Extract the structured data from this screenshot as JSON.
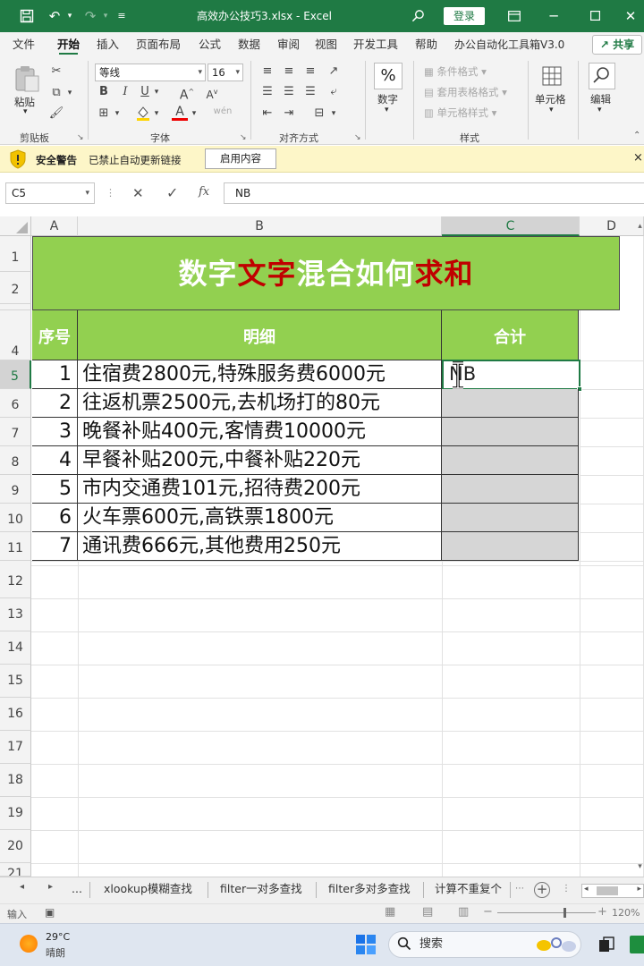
{
  "titlebar": {
    "title": "高效办公技巧3.xlsx  -  Excel",
    "login": "登录"
  },
  "menu": {
    "tabs": [
      "文件",
      "开始",
      "插入",
      "页面布局",
      "公式",
      "数据",
      "审阅",
      "视图",
      "开发工具",
      "帮助",
      "办公自动化工具箱V3.0"
    ],
    "share": "共享"
  },
  "ribbon": {
    "paste_label": "粘贴",
    "font_name": "等线",
    "font_size": "16",
    "number_label": "数字",
    "percent": "%",
    "cond_format": "条件格式",
    "table_format": "套用表格格式",
    "cell_style": "单元格样式",
    "cells_label": "单元格",
    "edit_label": "编辑",
    "groups": {
      "clipboard": "剪贴板",
      "font": "字体",
      "align": "对齐方式",
      "style": "样式"
    },
    "bold": "B",
    "italic": "I",
    "underline": "U",
    "font_grow": "A",
    "font_shrink": "A",
    "font_color": "A",
    "wen": "wén"
  },
  "security": {
    "title": "安全警告",
    "message": "已禁止自动更新链接",
    "button": "启用内容",
    "close": "×"
  },
  "formula": {
    "namebox": "C5",
    "cancel": "✕",
    "confirm": "✓",
    "fx": "fx",
    "value": "NB"
  },
  "grid": {
    "columns": [
      "A",
      "B",
      "C",
      "D"
    ],
    "rows": [
      "1",
      "2",
      "4",
      "5",
      "6",
      "7",
      "8",
      "9",
      "10",
      "11",
      "12",
      "13",
      "14",
      "15",
      "16",
      "17",
      "18",
      "19",
      "20",
      "21"
    ],
    "title_parts": [
      {
        "text": "数字",
        "red": false
      },
      {
        "text": "文字",
        "red": true
      },
      {
        "text": "混合如何",
        "red": false
      },
      {
        "text": "求和",
        "red": true
      }
    ],
    "headers": {
      "seq": "序号",
      "detail": "明细",
      "total": "合计"
    },
    "data": [
      {
        "seq": "1",
        "detail": "住宿费2800元,特殊服务费6000元",
        "total": "NB"
      },
      {
        "seq": "2",
        "detail": "往返机票2500元,去机场打的80元",
        "total": ""
      },
      {
        "seq": "3",
        "detail": "晚餐补贴400元,客情费10000元",
        "total": ""
      },
      {
        "seq": "4",
        "detail": "早餐补贴200元,中餐补贴220元",
        "total": ""
      },
      {
        "seq": "5",
        "detail": "市内交通费101元,招待费200元",
        "total": ""
      },
      {
        "seq": "6",
        "detail": "火车票600元,高铁票1800元",
        "total": ""
      },
      {
        "seq": "7",
        "detail": "通讯费666元,其他费用250元",
        "total": ""
      }
    ]
  },
  "sheets": {
    "ellipsis": "...",
    "tabs": [
      "xlookup模糊查找",
      "filter一对多查找",
      "filter多对多查找",
      "计算不重复个"
    ],
    "add": "+"
  },
  "status": {
    "mode": "输入",
    "zoom": "120%"
  },
  "taskbar": {
    "temp": "29°C",
    "weather": "晴朗",
    "search": "搜索"
  },
  "colors": {
    "excel_green": "#1f7a44",
    "banner_green": "#92d050",
    "title_red": "#c00000"
  }
}
